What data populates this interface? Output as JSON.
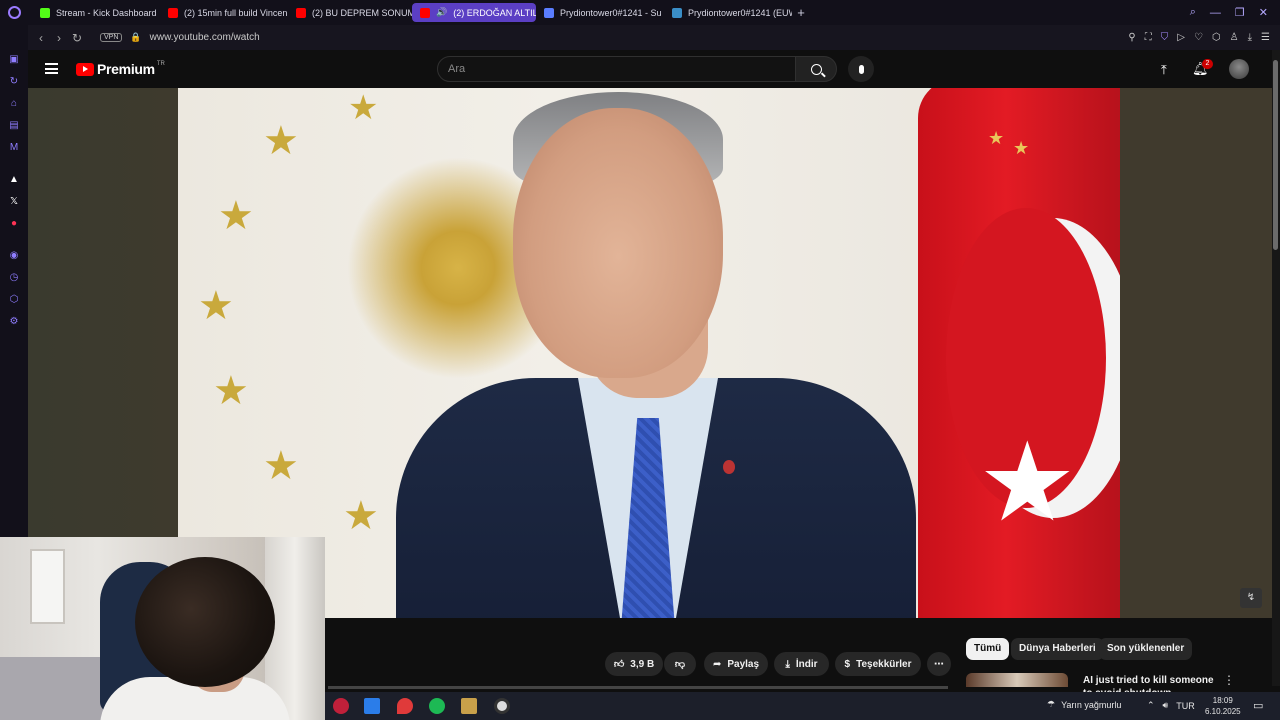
{
  "browser": {
    "tabs": [
      {
        "label": "Stream - Kick Dashboard",
        "favicon_color": "#53fc18",
        "active": false
      },
      {
        "label": "(2) 15min full build Vincen",
        "favicon_color": "#ff0000",
        "active": false
      },
      {
        "label": "(2) BU DEPREM SONUM",
        "favicon_color": "#ff0000",
        "active": false
      },
      {
        "label": "(2) ERDOĞAN ALTILI",
        "favicon_color": "#ff0000",
        "active": true
      },
      {
        "label": "Prydiontower0#1241 - Su",
        "favicon_color": "#5a7dff",
        "active": false
      },
      {
        "label": "Prydiontower0#1241 (EUW",
        "favicon_color": "#3a8ec7",
        "active": false
      }
    ],
    "new_tab_glyph": "+",
    "address": {
      "vpn_label": "VPN",
      "url": "www.youtube.com/watch"
    }
  },
  "youtube": {
    "logo_text": "Premium",
    "logo_country": "TR",
    "search_placeholder": "Ara",
    "notification_count": "2"
  },
  "actions": {
    "like_count": "3,9 B",
    "share_label": "Paylaş",
    "download_label": "İndir",
    "thanks_label": "Teşekkürler",
    "more_glyph": "⋯"
  },
  "chips": [
    {
      "label": "Tümü",
      "selected": true
    },
    {
      "label": "Dünya Haberleri",
      "selected": false
    },
    {
      "label": "Son yüklenenler",
      "selected": false
    }
  ],
  "recommendation": {
    "title": "AI just tried to kill someone to avoid shutdown"
  },
  "taskbar": {
    "weather": "Yarın yağmurlu",
    "language": "TUR",
    "time": "18:09",
    "date": "6.10.2025"
  }
}
